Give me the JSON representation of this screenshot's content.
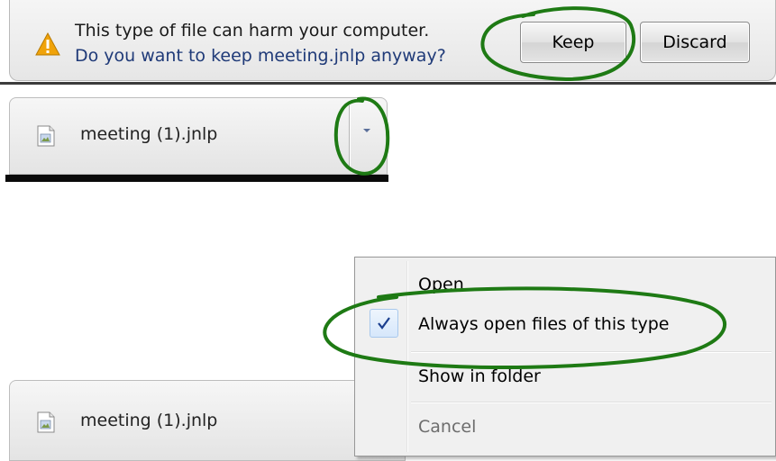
{
  "warning_bar": {
    "line1": "This type of file can harm your computer.",
    "line2": "Do you want to keep meeting.jnlp anyway?",
    "keep_label": "Keep",
    "discard_label": "Discard",
    "icon": "warning-triangle-icon",
    "icon_color": "#f0a30a"
  },
  "download_item": {
    "filename": "meeting (1).jnlp",
    "icon": "jnlp-file-icon",
    "menu_icon": "chevron-down-icon"
  },
  "download_item_menu_open": {
    "filename": "meeting (1).jnlp",
    "icon": "jnlp-file-icon"
  },
  "context_menu": {
    "items": [
      {
        "label": "Open",
        "checked": false,
        "enabled": true
      },
      {
        "label": "Always open files of this type",
        "checked": true,
        "enabled": true
      },
      {
        "label": "Show in folder",
        "checked": false,
        "enabled": true
      },
      {
        "label": "Cancel",
        "checked": false,
        "enabled": false
      }
    ],
    "check_icon": "checkmark-icon"
  },
  "colors": {
    "annotation": "#1e7a14",
    "link_text": "#1f3a78",
    "check_color": "#1b3f8f"
  }
}
